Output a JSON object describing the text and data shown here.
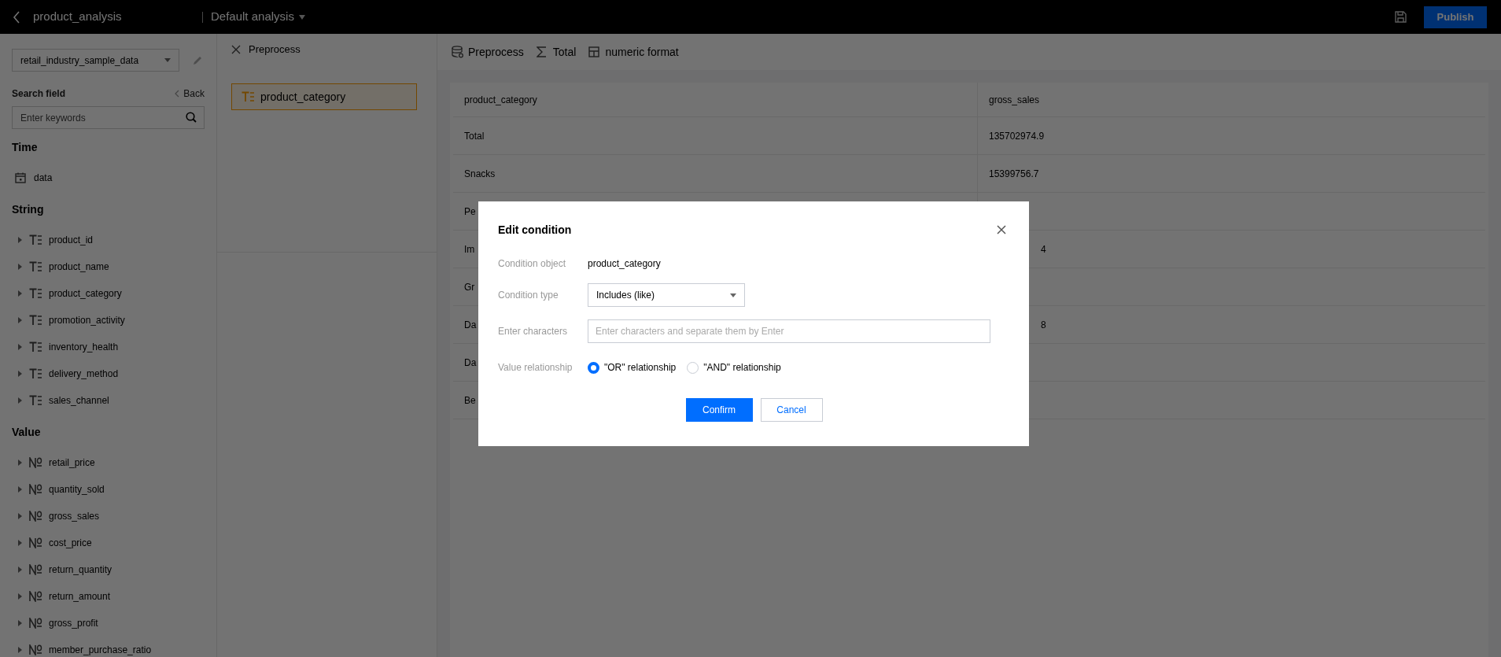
{
  "top_bar": {
    "title": "product_analysis",
    "analysis_name": "Default analysis",
    "publish_button": "Publish"
  },
  "sidebar": {
    "dataset": "retail_industry_sample_data",
    "search_label": "Search field",
    "back_link": "Back",
    "search_placeholder": "Enter keywords",
    "groups": [
      {
        "title": "Time",
        "fields": [
          {
            "name": "data",
            "kind": "date"
          }
        ]
      },
      {
        "title": "String",
        "fields": [
          {
            "name": "product_id",
            "kind": "text",
            "expanded": false
          },
          {
            "name": "product_name",
            "kind": "text",
            "expanded": false
          },
          {
            "name": "product_category",
            "kind": "text",
            "expanded": false
          },
          {
            "name": "promotion_activity",
            "kind": "text",
            "expanded": false
          },
          {
            "name": "inventory_health",
            "kind": "text",
            "expanded": false
          },
          {
            "name": "delivery_method",
            "kind": "text",
            "expanded": false
          },
          {
            "name": "sales_channel",
            "kind": "text",
            "expanded": false
          }
        ]
      },
      {
        "title": "Value",
        "fields": [
          {
            "name": "retail_price",
            "kind": "number",
            "expanded": false
          },
          {
            "name": "quantity_sold",
            "kind": "number",
            "expanded": false
          },
          {
            "name": "gross_sales",
            "kind": "number",
            "expanded": false
          },
          {
            "name": "cost_price",
            "kind": "number",
            "expanded": false
          },
          {
            "name": "return_quantity",
            "kind": "number",
            "expanded": false
          },
          {
            "name": "return_amount",
            "kind": "number",
            "expanded": false
          },
          {
            "name": "gross_profit",
            "kind": "number",
            "expanded": false
          },
          {
            "name": "member_purchase_ratio",
            "kind": "number",
            "expanded": false
          }
        ]
      }
    ]
  },
  "preprocess_panel": {
    "title": "Preprocess",
    "selected_field": "product_category"
  },
  "toolbar": [
    {
      "label": "Preprocess",
      "kind": "preprocess"
    },
    {
      "label": "Total",
      "kind": "total"
    },
    {
      "label": "numeric format",
      "kind": "format"
    }
  ],
  "table": {
    "columns": [
      "product_category",
      "gross_sales"
    ],
    "rows": [
      {
        "kind": "full",
        "product_category": "Total",
        "gross_sales": "135702974.9"
      },
      {
        "kind": "full",
        "product_category": "Snacks",
        "gross_sales": "15399756.7"
      },
      {
        "kind": "covered",
        "product_category": "Pe"
      },
      {
        "kind": "covered",
        "product_category": "Im",
        "gross_sales": "4"
      },
      {
        "kind": "covered",
        "product_category": "Gr"
      },
      {
        "kind": "covered",
        "product_category": "Da",
        "gross_sales": "8"
      },
      {
        "kind": "covered",
        "product_category": "Da"
      },
      {
        "kind": "covered",
        "product_category": "Be"
      }
    ]
  },
  "modal": {
    "title": "Edit condition",
    "condition_object": {
      "label": "Condition object",
      "value": "product_category"
    },
    "condition_type": {
      "label": "Condition type",
      "value": "Includes (like)"
    },
    "enter_characters": {
      "label": "Enter characters",
      "placeholder": "Enter characters and separate them by Enter"
    },
    "value_relationship": {
      "label": "Value relationship",
      "options": [
        {
          "label": "\"OR\" relationship",
          "selected": true
        },
        {
          "label": "\"AND\" relationship",
          "selected": false
        }
      ]
    },
    "confirm_button": "Confirm",
    "cancel_button": "Cancel"
  }
}
